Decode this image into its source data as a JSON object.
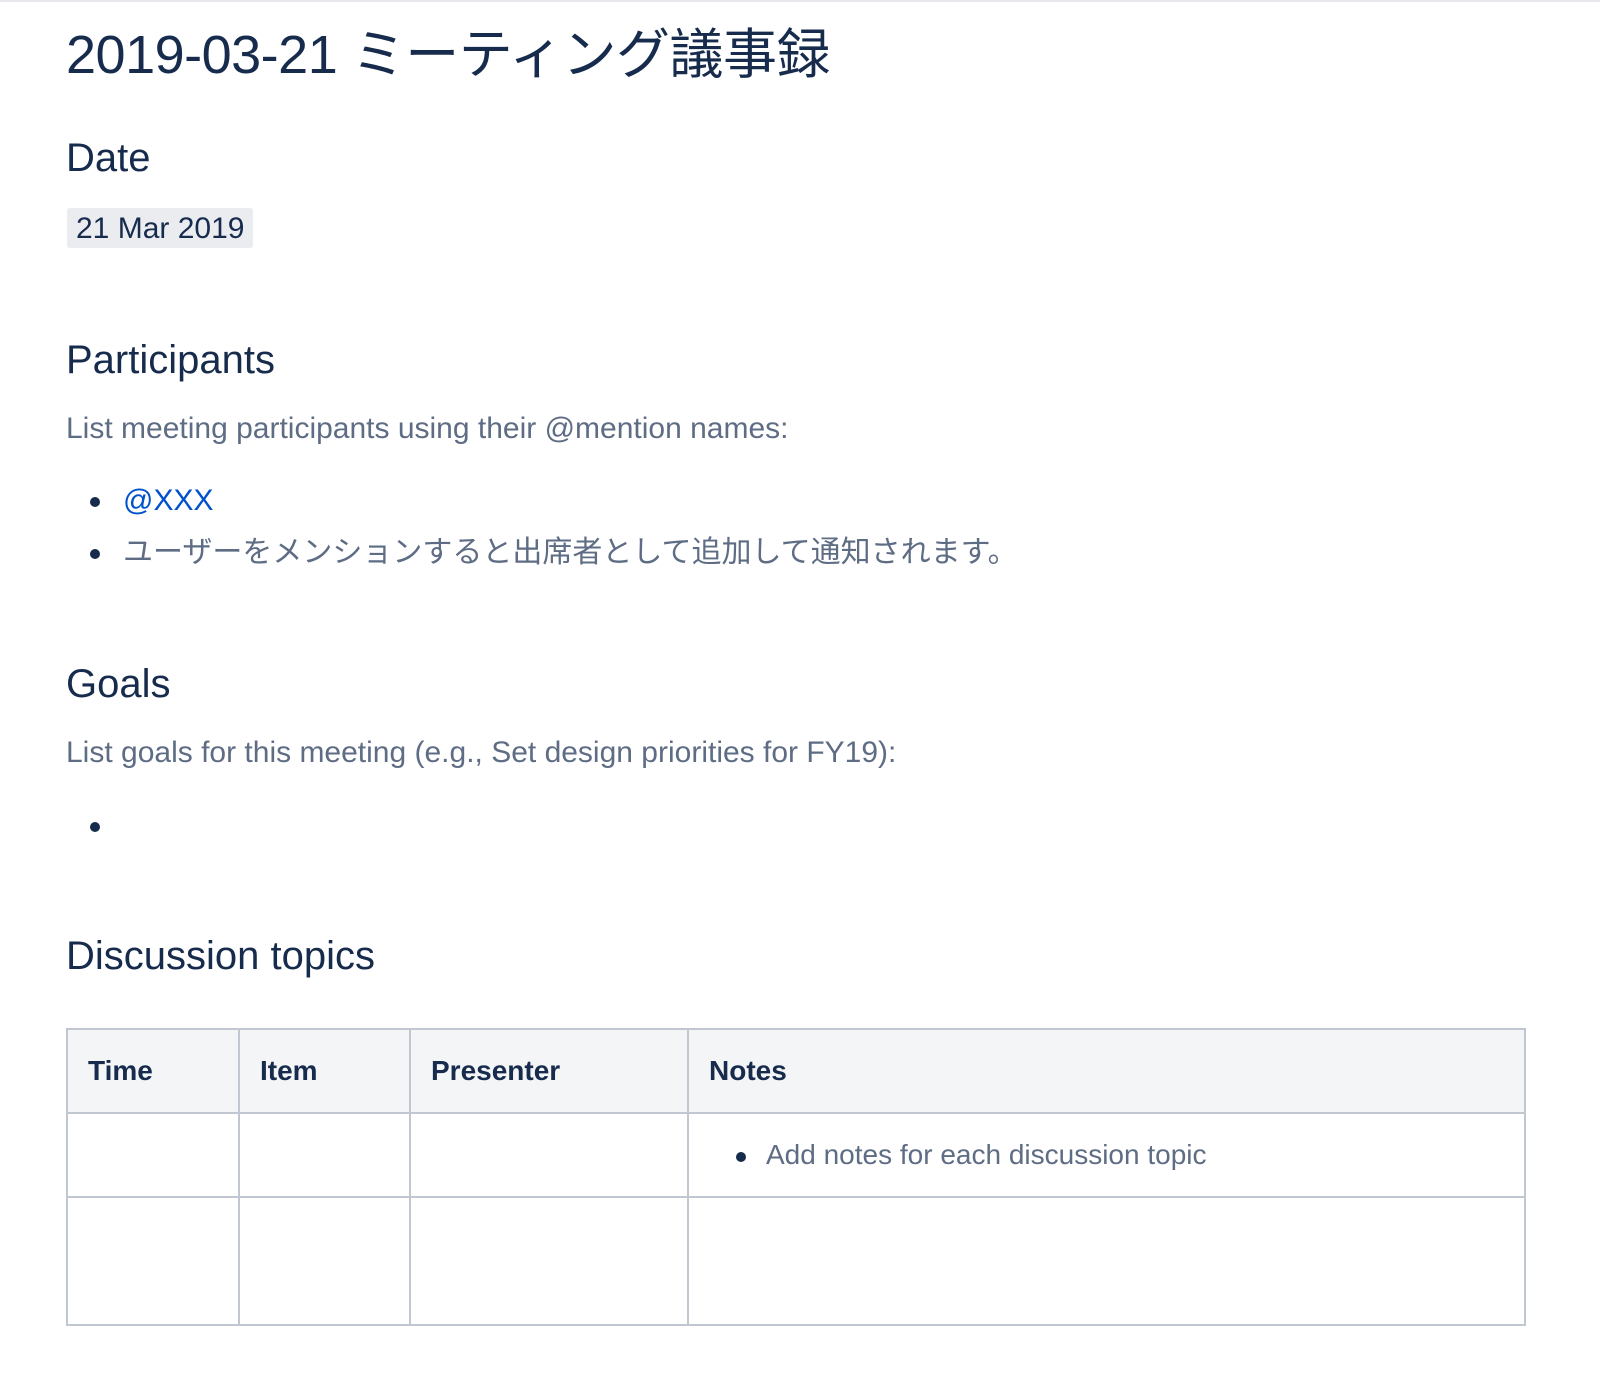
{
  "page": {
    "title": "2019-03-21 ミーティング議事録"
  },
  "date_section": {
    "heading": "Date",
    "value": "21 Mar 2019"
  },
  "participants": {
    "heading": "Participants",
    "hint": "List meeting participants using their @mention names:",
    "items": [
      "@XXX",
      "ユーザーをメンションすると出席者として追加して通知されます。"
    ]
  },
  "goals": {
    "heading": "Goals",
    "hint": "List goals for this meeting (e.g., Set design priorities for FY19):",
    "items": [
      ""
    ]
  },
  "discussion": {
    "heading": "Discussion topics",
    "columns": [
      "Time",
      "Item",
      "Presenter",
      "Notes"
    ],
    "rows": [
      {
        "time": "",
        "item": "",
        "presenter": "",
        "notes": "Add notes for each discussion topic"
      },
      {
        "time": "",
        "item": "",
        "presenter": "",
        "notes": ""
      }
    ]
  },
  "colors": {
    "text": "#172b4d",
    "subtle_text": "#5e6c84",
    "mention": "#0052cc",
    "table_header_bg": "#f4f5f7",
    "border": "#c1c7d0"
  }
}
